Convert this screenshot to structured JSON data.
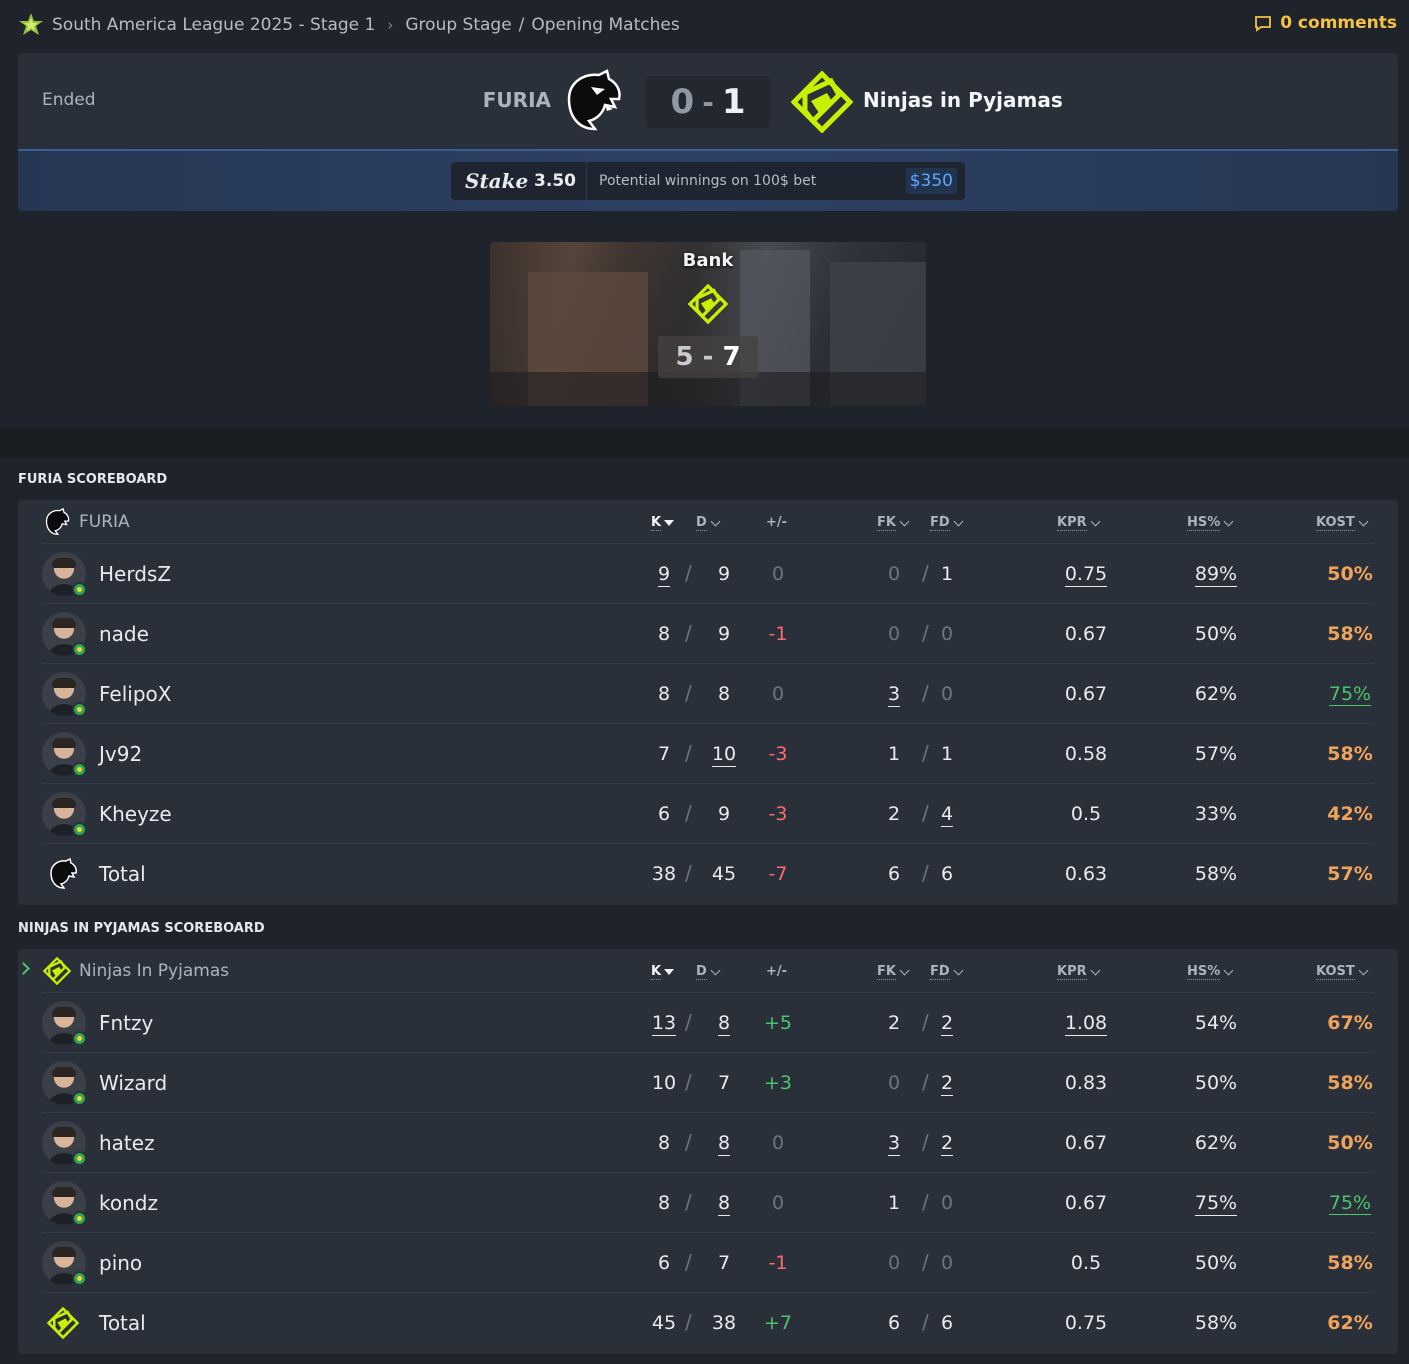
{
  "breadcrumb": {
    "tournament": "South America League 2025 - Stage 1",
    "stage": "Group Stage",
    "round": "Opening Matches"
  },
  "comments_label": "0 comments",
  "match": {
    "status": "Ended",
    "team1": "FURIA",
    "team2": "Ninjas in Pyjamas",
    "score1": "0",
    "score_sep": "-",
    "score2": "1"
  },
  "bet": {
    "brand": "Stake",
    "odds": "3.50",
    "text": "Potential winnings on 100$ bet",
    "winnings": "$350"
  },
  "map": {
    "name": "Bank",
    "score_left": "5",
    "score_sep": "-",
    "score_right": "7"
  },
  "columns": {
    "k": "K",
    "d": "D",
    "pm": "+/-",
    "fk": "FK",
    "slash": "/",
    "fd": "FD",
    "kpr": "KPR",
    "hs": "HS%",
    "kost": "KOST"
  },
  "scoreboards": [
    {
      "title": "FURIA SCOREBOARD",
      "team_name": "FURIA",
      "players": [
        {
          "name": "HerdsZ",
          "k": "9",
          "d": "9",
          "pm": "0",
          "fk": "0",
          "fd": "1",
          "kpr": "0.75",
          "hs": "89%",
          "kost": "50%"
        },
        {
          "name": "nade",
          "k": "8",
          "d": "9",
          "pm": "-1",
          "fk": "0",
          "fd": "0",
          "kpr": "0.67",
          "hs": "50%",
          "kost": "58%"
        },
        {
          "name": "FelipoX",
          "k": "8",
          "d": "8",
          "pm": "0",
          "fk": "3",
          "fd": "0",
          "kpr": "0.67",
          "hs": "62%",
          "kost": "75%"
        },
        {
          "name": "Jv92",
          "k": "7",
          "d": "10",
          "pm": "-3",
          "fk": "1",
          "fd": "1",
          "kpr": "0.58",
          "hs": "57%",
          "kost": "58%"
        },
        {
          "name": "Kheyze",
          "k": "6",
          "d": "9",
          "pm": "-3",
          "fk": "2",
          "fd": "4",
          "kpr": "0.5",
          "hs": "33%",
          "kost": "42%"
        }
      ],
      "total": {
        "label": "Total",
        "k": "38",
        "d": "45",
        "pm": "-7",
        "fk": "6",
        "fd": "6",
        "kpr": "0.63",
        "hs": "58%",
        "kost": "57%"
      }
    },
    {
      "title": "NINJAS IN PYJAMAS SCOREBOARD",
      "team_name": "Ninjas In Pyjamas",
      "players": [
        {
          "name": "Fntzy",
          "k": "13",
          "d": "8",
          "pm": "+5",
          "fk": "2",
          "fd": "2",
          "kpr": "1.08",
          "hs": "54%",
          "kost": "67%"
        },
        {
          "name": "Wizard",
          "k": "10",
          "d": "7",
          "pm": "+3",
          "fk": "0",
          "fd": "2",
          "kpr": "0.83",
          "hs": "50%",
          "kost": "58%"
        },
        {
          "name": "hatez",
          "k": "8",
          "d": "8",
          "pm": "0",
          "fk": "3",
          "fd": "2",
          "kpr": "0.67",
          "hs": "62%",
          "kost": "50%"
        },
        {
          "name": "kondz",
          "k": "8",
          "d": "8",
          "pm": "0",
          "fk": "1",
          "fd": "0",
          "kpr": "0.67",
          "hs": "75%",
          "kost": "75%"
        },
        {
          "name": "pino",
          "k": "6",
          "d": "7",
          "pm": "-1",
          "fk": "0",
          "fd": "0",
          "kpr": "0.5",
          "hs": "50%",
          "kost": "58%"
        }
      ],
      "total": {
        "label": "Total",
        "k": "45",
        "d": "38",
        "pm": "+7",
        "fk": "6",
        "fd": "6",
        "kpr": "0.75",
        "hs": "58%",
        "kost": "62%"
      }
    }
  ],
  "colors": {
    "accent_yellow": "#f5c242",
    "nip_green": "#c8f000",
    "positive": "#4cc46a",
    "negative": "#ff6b6b",
    "kost_orange": "#f0a45b",
    "link_blue": "#59a8ff"
  },
  "icons": {
    "tournament": "star-logo-icon",
    "comments": "comment-bubble-icon",
    "furia": "panther-logo-icon",
    "nip": "nip-logo-icon"
  }
}
